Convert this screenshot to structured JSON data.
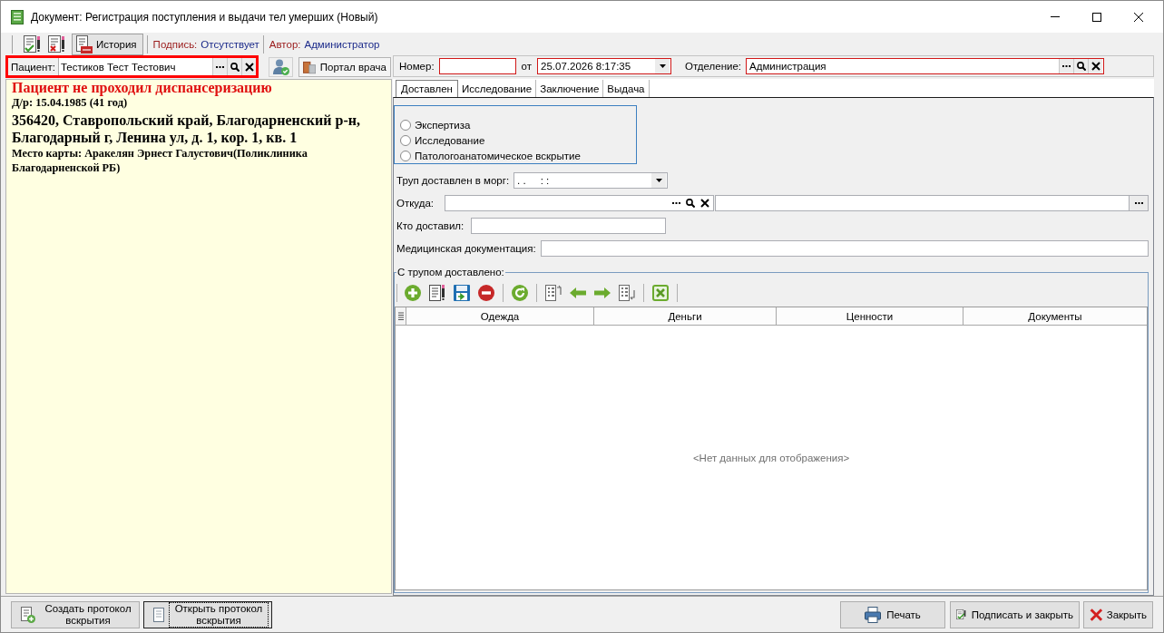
{
  "window": {
    "title": "Документ: Регистрация поступления и выдачи тел умерших (Новый)"
  },
  "toolbar": {
    "history": {
      "label": "История",
      "pressed": true
    },
    "signature": {
      "label": "Подпись:",
      "value": "Отсутствует"
    },
    "author": {
      "label": "Автор:",
      "value": "Администратор"
    }
  },
  "patient": {
    "label": "Пациент:",
    "value": "Тестиков Тест Тестович",
    "highlighted": true
  },
  "portal_button": {
    "label": "Портал врача"
  },
  "patient_info": {
    "warning": "Пациент не проходил диспансеризацию",
    "birth": "Д/р: 15.04.1985 (41 год)",
    "address": "356420, Ставропольский край, Благодарненский р-н, Благодарный г, Ленина ул, д. 1, кор. 1, кв. 1",
    "card": "Место карты: Аракелян Эрнест Галустович(Поликлиника Благодарненской РБ)"
  },
  "header": {
    "number": {
      "label": "Номер:",
      "required": true
    },
    "date": {
      "label": "от",
      "value": "25.07.2026 8:17:35",
      "required": true
    },
    "department": {
      "label": "Отделение:",
      "value": "Администрация",
      "required": true
    }
  },
  "tabs": [
    {
      "label": "Доставлен",
      "selected": true
    },
    {
      "label": "Исследование",
      "selected": false
    },
    {
      "label": "Заключение",
      "selected": false
    },
    {
      "label": "Выдача",
      "selected": false
    }
  ],
  "exam_type": {
    "options": [
      {
        "label": "Экспертиза",
        "selected": false
      },
      {
        "label": "Исследование",
        "selected": false
      },
      {
        "label": "Патологоанатомическое вскрытие",
        "selected": false
      }
    ]
  },
  "fields": {
    "delivered_at": {
      "label": "Труп доставлен в морг:",
      "value": ". .     : :"
    },
    "from": {
      "label": "Откуда:"
    },
    "delivered_by": {
      "label": "Кто доставил:"
    },
    "medical_docs": {
      "label": "Медицинская документация:"
    }
  },
  "belongings": {
    "title": "С трупом доставлено:",
    "columns": [
      "Одежда",
      "Деньги",
      "Ценности",
      "Документы"
    ],
    "empty_text": "<Нет данных для отображения>"
  },
  "bottom_left": [
    {
      "kind": "create",
      "label": "Создать протокол вскрытия",
      "focused": false
    },
    {
      "kind": "open",
      "label": "Открыть протокол вскрытия",
      "focused": true
    }
  ],
  "bottom_right": [
    {
      "kind": "print",
      "label": "Печать"
    },
    {
      "kind": "sign",
      "label": "Подписать и закрыть"
    },
    {
      "kind": "close",
      "label": "Закрыть"
    }
  ]
}
